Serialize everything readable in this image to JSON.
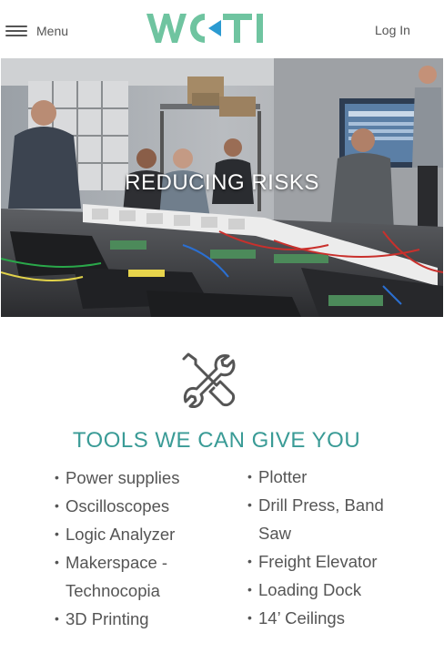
{
  "header": {
    "menu_label": "Menu",
    "logo_text": "WCTI",
    "login_label": "Log In"
  },
  "hero": {
    "title": "REDUCING RISKS"
  },
  "tools": {
    "heading": "TOOLS WE CAN GIVE YOU",
    "left_items": [
      {
        "label": "Power supplies"
      },
      {
        "label": "Oscilloscopes"
      },
      {
        "label": "Logic Analyzer"
      },
      {
        "label": "Makerspace - Technocopia"
      },
      {
        "label": "3D Printing"
      }
    ],
    "right_items": [
      {
        "label": "Plotter"
      },
      {
        "label": "Drill Press, Band Saw"
      },
      {
        "label": "Freight Elevator"
      },
      {
        "label": "Loading Dock"
      },
      {
        "label": "14’ Ceilings"
      }
    ]
  },
  "colors": {
    "brand_green": "#6fc4a0",
    "accent_teal": "#3a9b96",
    "text_gray": "#555555"
  },
  "icons": {
    "menu": "hamburger-icon",
    "tools": "wrench-screwdriver-icon"
  }
}
